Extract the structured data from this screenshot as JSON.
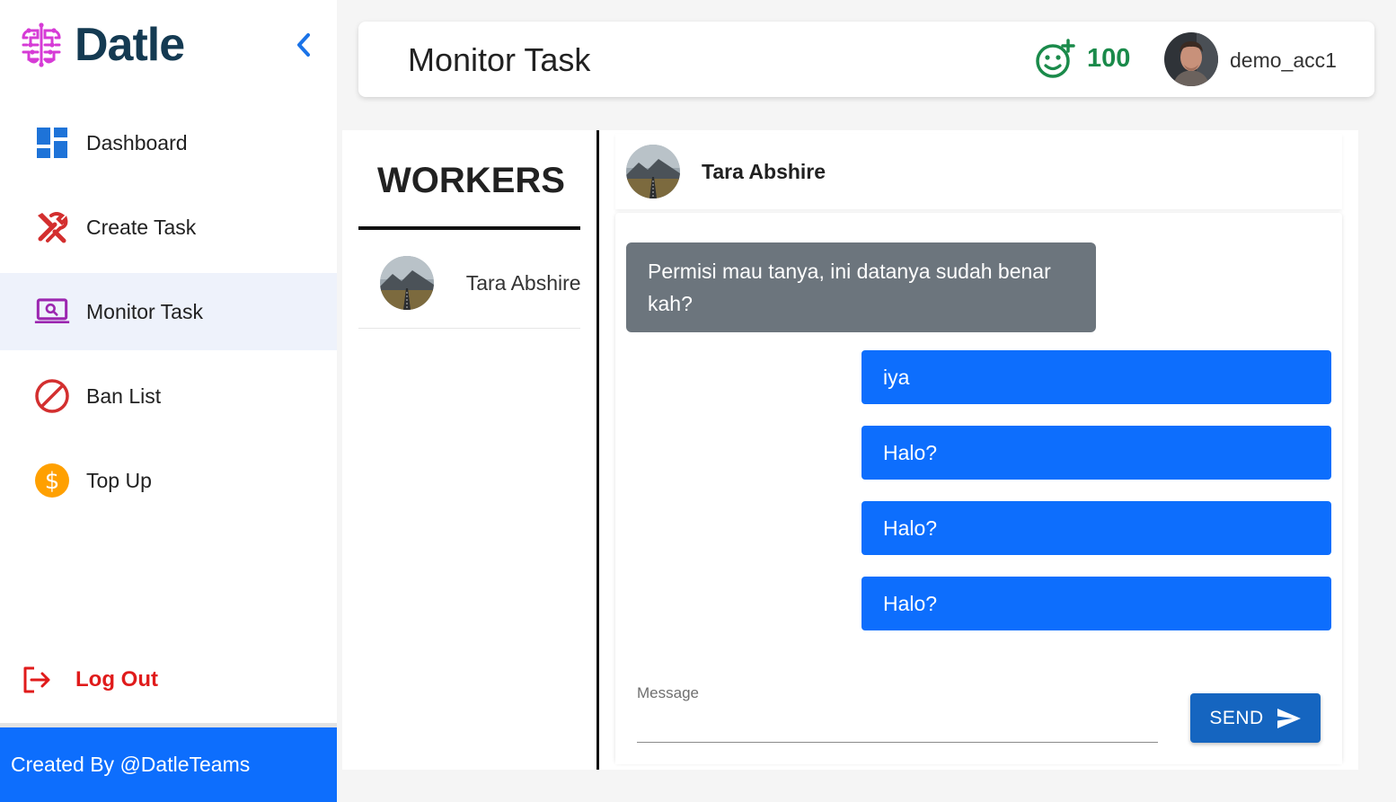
{
  "app": {
    "name": "Datle",
    "logo_icon": "brain-circuit-icon",
    "brand_color": "#143a52",
    "accent_color": "#0d6efd"
  },
  "sidebar": {
    "collapse_icon": "chevron-left-icon",
    "items": [
      {
        "label": "Dashboard",
        "icon": "dashboard-icon",
        "active": false
      },
      {
        "label": "Create Task",
        "icon": "tools-icon",
        "active": false
      },
      {
        "label": "Monitor Task",
        "icon": "laptop-search-icon",
        "active": true
      },
      {
        "label": "Ban List",
        "icon": "ban-icon",
        "active": false
      },
      {
        "label": "Top Up",
        "icon": "dollar-coin-icon",
        "active": false
      }
    ],
    "logout_label": "Log Out",
    "logout_icon": "logout-icon",
    "footer_text": "Created By @DatleTeams"
  },
  "header": {
    "title": "Monitor Task",
    "points_icon": "smiley-plus-icon",
    "points": "100",
    "username": "demo_acc1"
  },
  "workers": {
    "title": "WORKERS",
    "list": [
      {
        "name": "Tara Abshire"
      }
    ]
  },
  "chat": {
    "contact_name": "Tara Abshire",
    "messages": [
      {
        "direction": "incoming",
        "text": "Permisi mau tanya, ini datanya sudah benar kah?"
      },
      {
        "direction": "outgoing",
        "text": "iya"
      },
      {
        "direction": "outgoing",
        "text": "Halo?"
      },
      {
        "direction": "outgoing",
        "text": "Halo?"
      },
      {
        "direction": "outgoing",
        "text": "Halo?"
      }
    ],
    "input_label": "Message",
    "input_value": "",
    "send_label": "SEND",
    "send_icon": "send-icon"
  }
}
